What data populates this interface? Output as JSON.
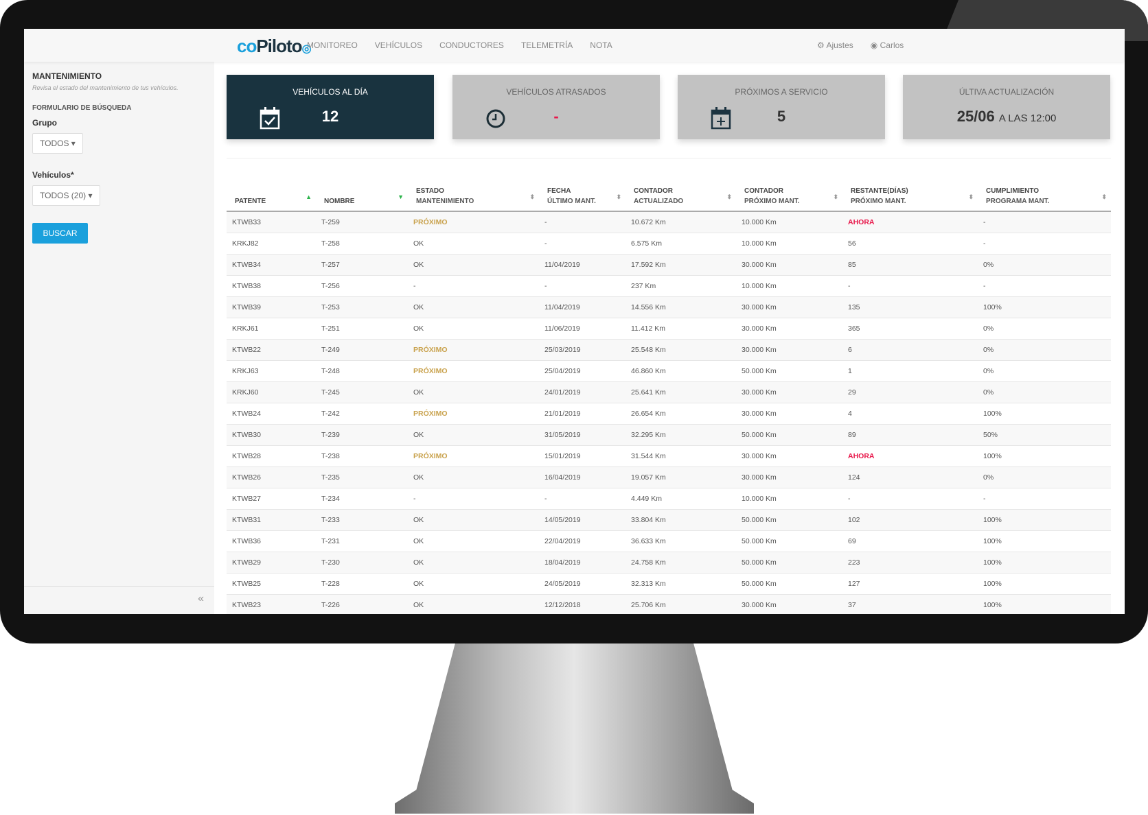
{
  "app": {
    "logo": "coPiloto"
  },
  "nav": {
    "items": [
      "MONITOREO",
      "VEHÍCULOS",
      "CONDUCTORES",
      "TELEMETRÍA",
      "NOTA"
    ],
    "settings": "Ajustes",
    "user": "Carlos"
  },
  "sidebar": {
    "title": "MANTENIMIENTO",
    "subtitle": "Revisa el estado del mantenimiento de tus vehículos.",
    "form_title": "FORMULARIO DE BÚSQUEDA",
    "group_label": "Grupo",
    "group_value": "TODOS",
    "vehicles_label": "Vehículos*",
    "vehicles_value": "TODOS (20)",
    "search_button": "BUSCAR",
    "collapse": "«"
  },
  "cards": [
    {
      "title": "VEHÍCULOS AL DÍA",
      "value": "12",
      "icon": "calendar-check-icon"
    },
    {
      "title": "VEHÍCULOS ATRASADOS",
      "value": "-",
      "icon": "clock-icon"
    },
    {
      "title": "PRÓXIMOS A SERVICIO",
      "value": "5",
      "icon": "calendar-plus-icon"
    },
    {
      "title": "ÚLTIVA ACTUALIZACIÓN",
      "date": "25/06",
      "time": "A LAS 12:00"
    }
  ],
  "colors": {
    "accent": "#1aa0dc",
    "dark_card": "#19333f",
    "proximo": "#c9a24d",
    "ahora": "#e8174a"
  },
  "table": {
    "headers": [
      [
        "PATENTE",
        ""
      ],
      [
        "NOMBRE",
        ""
      ],
      [
        "ESTADO",
        "MANTENIMIENTO"
      ],
      [
        "FECHA",
        "ÚLTIMO MANT."
      ],
      [
        "CONTADOR",
        "ACTUALIZADO"
      ],
      [
        "CONTADOR",
        "PRÓXIMO MANT."
      ],
      [
        "RESTANTE(DÍAS)",
        "PRÓXIMO MANT."
      ],
      [
        "CUMPLIMIENTO",
        "PROGRAMA MANT."
      ]
    ],
    "rows": [
      [
        "KTWB33",
        "T-259",
        "PRÓXIMO",
        "-",
        "10.672 Km",
        "10.000 Km",
        "AHORA",
        "-"
      ],
      [
        "KRKJ82",
        "T-258",
        "OK",
        "-",
        "6.575 Km",
        "10.000 Km",
        "56",
        "-"
      ],
      [
        "KTWB34",
        "T-257",
        "OK",
        "11/04/2019",
        "17.592 Km",
        "30.000 Km",
        "85",
        "0%"
      ],
      [
        "KTWB38",
        "T-256",
        "-",
        "-",
        "237 Km",
        "10.000 Km",
        "-",
        "-"
      ],
      [
        "KTWB39",
        "T-253",
        "OK",
        "11/04/2019",
        "14.556 Km",
        "30.000 Km",
        "135",
        "100%"
      ],
      [
        "KRKJ61",
        "T-251",
        "OK",
        "11/06/2019",
        "11.412 Km",
        "30.000 Km",
        "365",
        "0%"
      ],
      [
        "KTWB22",
        "T-249",
        "PRÓXIMO",
        "25/03/2019",
        "25.548 Km",
        "30.000 Km",
        "6",
        "0%"
      ],
      [
        "KRKJ63",
        "T-248",
        "PRÓXIMO",
        "25/04/2019",
        "46.860 Km",
        "50.000 Km",
        "1",
        "0%"
      ],
      [
        "KRKJ60",
        "T-245",
        "OK",
        "24/01/2019",
        "25.641 Km",
        "30.000 Km",
        "29",
        "0%"
      ],
      [
        "KTWB24",
        "T-242",
        "PRÓXIMO",
        "21/01/2019",
        "26.654 Km",
        "30.000 Km",
        "4",
        "100%"
      ],
      [
        "KTWB30",
        "T-239",
        "OK",
        "31/05/2019",
        "32.295 Km",
        "50.000 Km",
        "89",
        "50%"
      ],
      [
        "KTWB28",
        "T-238",
        "PRÓXIMO",
        "15/01/2019",
        "31.544 Km",
        "30.000 Km",
        "AHORA",
        "100%"
      ],
      [
        "KTWB26",
        "T-235",
        "OK",
        "16/04/2019",
        "19.057 Km",
        "30.000 Km",
        "124",
        "0%"
      ],
      [
        "KTWB27",
        "T-234",
        "-",
        "-",
        "4.449 Km",
        "10.000 Km",
        "-",
        "-"
      ],
      [
        "KTWB31",
        "T-233",
        "OK",
        "14/05/2019",
        "33.804 Km",
        "50.000 Km",
        "102",
        "100%"
      ],
      [
        "KTWB36",
        "T-231",
        "OK",
        "22/04/2019",
        "36.633 Km",
        "50.000 Km",
        "69",
        "100%"
      ],
      [
        "KTWB29",
        "T-230",
        "OK",
        "18/04/2019",
        "24.758 Km",
        "50.000 Km",
        "223",
        "100%"
      ],
      [
        "KTWB25",
        "T-228",
        "OK",
        "24/05/2019",
        "32.313 Km",
        "50.000 Km",
        "127",
        "100%"
      ],
      [
        "KTWB23",
        "T-226",
        "OK",
        "12/12/2018",
        "25.706 Km",
        "30.000 Km",
        "37",
        "100%"
      ]
    ]
  }
}
